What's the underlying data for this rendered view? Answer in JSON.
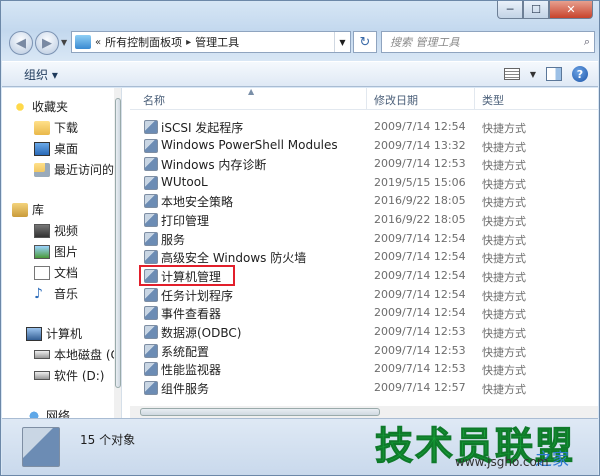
{
  "window": {
    "caption": {
      "min": "─",
      "max": "☐",
      "close": "✕"
    }
  },
  "nav": {
    "address": {
      "prefix": "«",
      "crumb1": "所有控制面板项",
      "sep": "▸",
      "crumb2": "管理工具"
    },
    "search_placeholder": "搜索 管理工具"
  },
  "toolbar": {
    "organize_label": "组织 ▾"
  },
  "sidebar": {
    "favorites": "收藏夹",
    "downloads": "下载",
    "desktop": "桌面",
    "recent": "最近访问的",
    "libraries": "库",
    "videos": "视频",
    "pictures": "图片",
    "documents": "文档",
    "music": "音乐",
    "computer": "计算机",
    "local_disk": "本地磁盘 (C",
    "software": "软件 (D:)",
    "network": "网络"
  },
  "columns": {
    "name": "名称",
    "date": "修改日期",
    "type": "类型"
  },
  "files": [
    {
      "name": "iSCSI 发起程序",
      "date": "2009/7/14 12:54",
      "type": "快捷方式"
    },
    {
      "name": "Windows PowerShell Modules",
      "date": "2009/7/14 13:32",
      "type": "快捷方式"
    },
    {
      "name": "Windows 内存诊断",
      "date": "2009/7/14 12:53",
      "type": "快捷方式"
    },
    {
      "name": "WUtooL",
      "date": "2019/5/15 15:06",
      "type": "快捷方式"
    },
    {
      "name": "本地安全策略",
      "date": "2016/9/22 18:05",
      "type": "快捷方式"
    },
    {
      "name": "打印管理",
      "date": "2016/9/22 18:05",
      "type": "快捷方式"
    },
    {
      "name": "服务",
      "date": "2009/7/14 12:54",
      "type": "快捷方式"
    },
    {
      "name": "高级安全 Windows 防火墙",
      "date": "2009/7/14 12:54",
      "type": "快捷方式"
    },
    {
      "name": "计算机管理",
      "date": "2009/7/14 12:54",
      "type": "快捷方式"
    },
    {
      "name": "任务计划程序",
      "date": "2009/7/14 12:54",
      "type": "快捷方式"
    },
    {
      "name": "事件查看器",
      "date": "2009/7/14 12:54",
      "type": "快捷方式"
    },
    {
      "name": "数据源(ODBC)",
      "date": "2009/7/14 12:53",
      "type": "快捷方式"
    },
    {
      "name": "系统配置",
      "date": "2009/7/14 12:53",
      "type": "快捷方式"
    },
    {
      "name": "性能监视器",
      "date": "2009/7/14 12:53",
      "type": "快捷方式"
    },
    {
      "name": "组件服务",
      "date": "2009/7/14 12:57",
      "type": "快捷方式"
    }
  ],
  "status": {
    "count_text": "15 个对象"
  },
  "watermark": {
    "title": "技术员联盟",
    "side": "之家",
    "url": "www.jsgho.com"
  }
}
